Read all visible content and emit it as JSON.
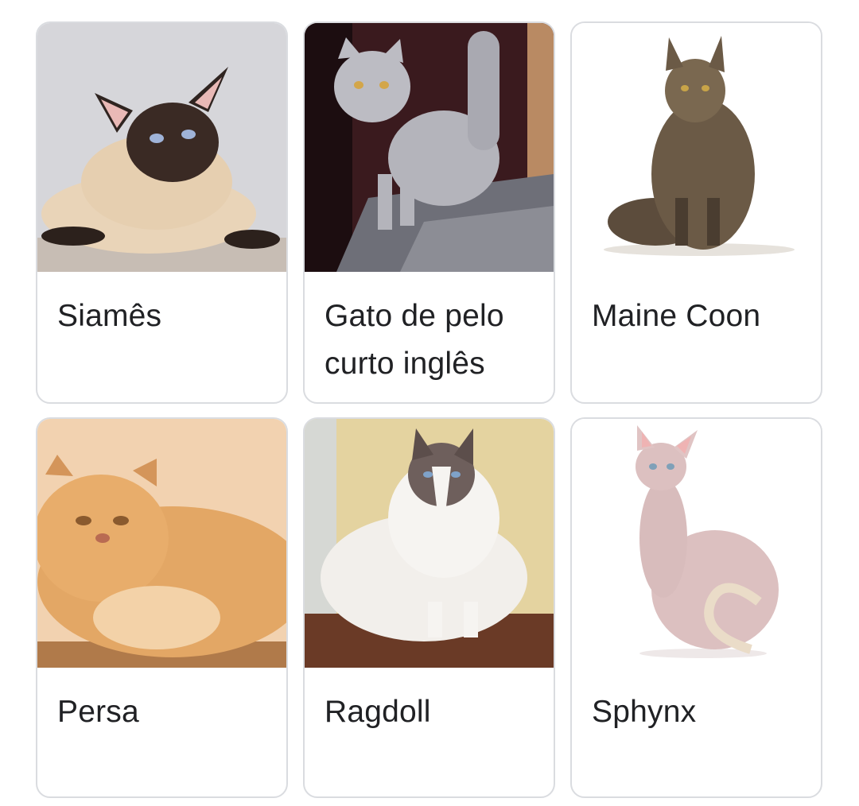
{
  "breeds": [
    {
      "name": "Siamês",
      "image_icon": "siamese-cat-photo",
      "colors": {
        "bg": "#d8d8dc",
        "coat": "#e6cfb0",
        "points": "#3a2a24"
      }
    },
    {
      "name": "Gato de pelo curto inglês",
      "image_icon": "british-shorthair-cat-photo",
      "colors": {
        "bg": "#3a1a1e",
        "coat": "#b9b9c0",
        "points": "#9a9aa2"
      }
    },
    {
      "name": "Maine Coon",
      "image_icon": "maine-coon-cat-photo",
      "colors": {
        "bg": "#ffffff",
        "coat": "#6b5a46",
        "points": "#3b3026"
      }
    },
    {
      "name": "Persa",
      "image_icon": "persian-cat-photo",
      "colors": {
        "bg": "#f2d2b0",
        "coat": "#e3a765",
        "points": "#b9773c"
      }
    },
    {
      "name": "Ragdoll",
      "image_icon": "ragdoll-cat-photo",
      "colors": {
        "bg": "#e4d3a0",
        "coat": "#f4f1ee",
        "points": "#6e5f5c"
      }
    },
    {
      "name": "Sphynx",
      "image_icon": "sphynx-cat-photo",
      "colors": {
        "bg": "#ffffff",
        "coat": "#dcc0c0",
        "points": "#c9a3a3"
      }
    }
  ]
}
